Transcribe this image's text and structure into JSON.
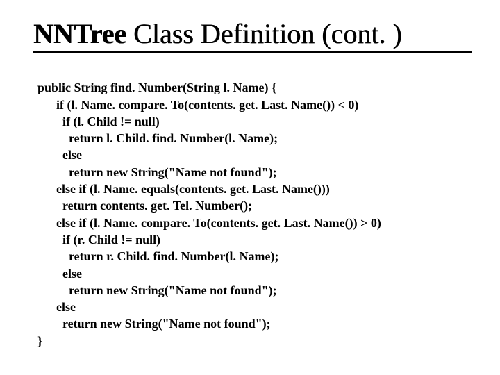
{
  "title_bold": "NNTree",
  "title_rest": " Class Definition (cont. )",
  "code": {
    "l01": "public String find. Number(String l. Name) {",
    "l02": "      if (l. Name. compare. To(contents. get. Last. Name()) < 0)",
    "l03": "        if (l. Child != null)",
    "l04": "          return l. Child. find. Number(l. Name);",
    "l05": "        else",
    "l06": "          return new String(\"Name not found\");",
    "l07": "      else if (l. Name. equals(contents. get. Last. Name()))",
    "l08": "        return contents. get. Tel. Number();",
    "l09": "      else if (l. Name. compare. To(contents. get. Last. Name()) > 0)",
    "l10": "        if (r. Child != null)",
    "l11": "          return r. Child. find. Number(l. Name);",
    "l12": "        else",
    "l13": "          return new String(\"Name not found\");",
    "l14": "      else",
    "l15": "        return new String(\"Name not found\");",
    "l16": "}"
  }
}
